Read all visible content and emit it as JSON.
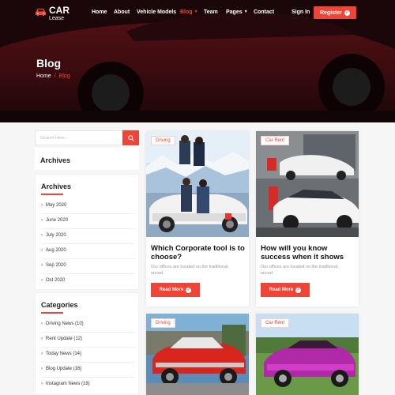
{
  "brand": {
    "line1": "CAR",
    "line2": "Lease"
  },
  "nav": {
    "items": [
      {
        "label": "Home",
        "dropdown": false
      },
      {
        "label": "About",
        "dropdown": false
      },
      {
        "label": "Vehicle Models",
        "dropdown": false
      },
      {
        "label": "Blog",
        "dropdown": true,
        "active": true
      },
      {
        "label": "Team",
        "dropdown": false
      },
      {
        "label": "Pages",
        "dropdown": true
      },
      {
        "label": "Contact",
        "dropdown": false
      }
    ],
    "signin": "Sign In",
    "register": "Register"
  },
  "hero": {
    "title": "Blog",
    "breadcrumb": {
      "home": "Home",
      "current": "Blog"
    }
  },
  "sidebar": {
    "search_placeholder": "Search Here...",
    "archives_heading_1": "Archives",
    "archives_heading_2": "Archives",
    "archives": [
      "May 2020",
      "June 2020",
      "July 2020",
      "Aug 2020",
      "Sep 2020",
      "Oct 2020"
    ],
    "categories_heading": "Categories",
    "categories": [
      "Driving News (10)",
      "Rent Update (12)",
      "Today News (14)",
      "Blog Update (16)",
      "Instagram News (18)"
    ]
  },
  "posts": [
    {
      "tag": "Driving",
      "title": "Which Corporate tool is to choose?",
      "desc": "Our offices are located on the traditional, unced.",
      "button": "Read More"
    },
    {
      "tag": "Car Rent",
      "title": "How will you know success when it shows",
      "desc": "Our offices are located on the traditional, unced.",
      "button": "Read More"
    },
    {
      "tag": "Driving"
    },
    {
      "tag": "Car Rent"
    }
  ],
  "colors": {
    "accent": "#ef4436",
    "heroDark": "#2a0c0e"
  }
}
